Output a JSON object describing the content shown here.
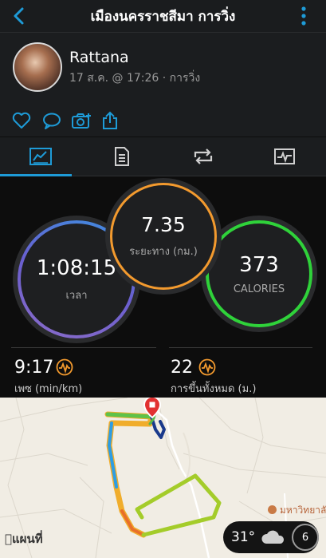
{
  "header": {
    "title": "เมืองนครราชสีมา การวิ่ง",
    "back_icon": "chevron-left-icon",
    "more_icon": "vertical-dots-icon",
    "accent": "#1e9bd7"
  },
  "activity": {
    "user": "Rattana",
    "meta": "17 ส.ค. @ 17:26 · การวิ่ง"
  },
  "actions": [
    "like-icon",
    "comment-icon",
    "camera-icon",
    "share-icon"
  ],
  "tabs": [
    {
      "name": "overview",
      "icon": "chart-icon",
      "active": true
    },
    {
      "name": "stats",
      "icon": "document-icon",
      "active": false
    },
    {
      "name": "laps",
      "icon": "repeat-icon",
      "active": false
    },
    {
      "name": "graphs",
      "icon": "pulse-icon",
      "active": false
    }
  ],
  "gauges": {
    "time": {
      "value": "1:08:15",
      "label": "เวลา",
      "color": "#5a7fe0"
    },
    "distance": {
      "value": "7.35",
      "label": "ระยะทาง (กม.)",
      "color": "#f39a2e"
    },
    "calories": {
      "value": "373",
      "label": "CALORIES",
      "color": "#2fd23a"
    }
  },
  "stats": {
    "pace": {
      "value": "9:17",
      "label": "เพซ (min/km)"
    },
    "ascent": {
      "value": "22",
      "label": "การขึ้นทั้งหมด (ม.)"
    }
  },
  "map": {
    "brand": "แผนที่",
    "poi": "มหาวิทยาลัย",
    "weather": {
      "temp": "31°",
      "aqi": "6"
    }
  }
}
